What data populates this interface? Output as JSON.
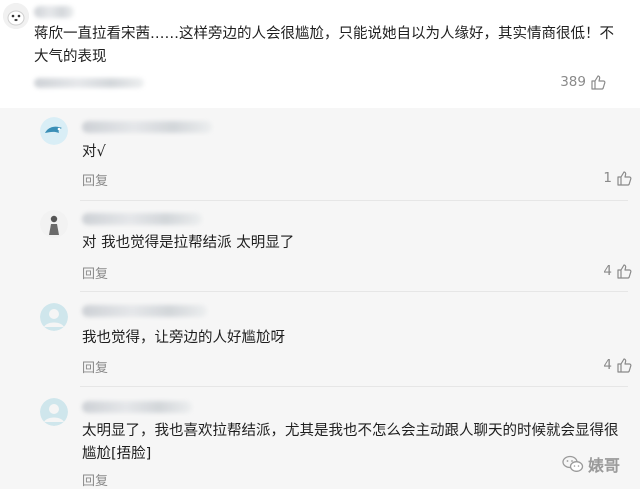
{
  "main_comment": {
    "text": "蒋欣一直拉看宋茜……这样旁边的人会很尴尬，只能说她自以为人缘好，其实情商很低！不大气的表现",
    "likes": "389"
  },
  "replies": [
    {
      "text": "对√",
      "reply_label": "回复",
      "likes": "1"
    },
    {
      "text": "对 我也觉得是拉帮结派 太明显了",
      "reply_label": "回复",
      "likes": "4"
    },
    {
      "text": "我也觉得，让旁边的人好尴尬呀",
      "reply_label": "回复",
      "likes": "4"
    },
    {
      "text": "太明显了，我也喜欢拉帮结派，尤其是我也不怎么会主动跟人聊天的时候就会显得很尴尬[捂脸]",
      "reply_label": "回复"
    }
  ],
  "watermark": {
    "text": "婊哥"
  },
  "colors": {
    "accent_gray": "#8a8a8a",
    "panel_bg": "#f6f6f6"
  },
  "icons": {
    "like": "thumb-up-icon",
    "watermark": "wechat-icon"
  }
}
